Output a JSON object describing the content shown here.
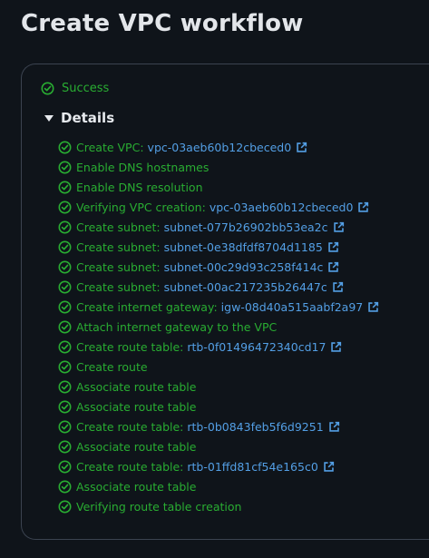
{
  "page": {
    "title": "Create VPC workflow"
  },
  "status": {
    "text": "Success",
    "icon": "check-circle-icon",
    "color": "#29ad32"
  },
  "details": {
    "title": "Details"
  },
  "colors": {
    "success": "#29ad32",
    "link": "#539fe5",
    "background": "#0f141a"
  },
  "steps": [
    {
      "label": "Create VPC:",
      "link": "vpc-03aeb60b12cbeced0"
    },
    {
      "label": "Enable DNS hostnames"
    },
    {
      "label": "Enable DNS resolution"
    },
    {
      "label": "Verifying VPC creation:",
      "link": "vpc-03aeb60b12cbeced0"
    },
    {
      "label": "Create subnet:",
      "link": "subnet-077b26902bb53ea2c"
    },
    {
      "label": "Create subnet:",
      "link": "subnet-0e38dfdf8704d1185"
    },
    {
      "label": "Create subnet:",
      "link": "subnet-00c29d93c258f414c"
    },
    {
      "label": "Create subnet:",
      "link": "subnet-00ac217235b26447c"
    },
    {
      "label": "Create internet gateway:",
      "link": "igw-08d40a515aabf2a97"
    },
    {
      "label": "Attach internet gateway to the VPC"
    },
    {
      "label": "Create route table:",
      "link": "rtb-0f01496472340cd17"
    },
    {
      "label": "Create route"
    },
    {
      "label": "Associate route table"
    },
    {
      "label": "Associate route table"
    },
    {
      "label": "Create route table:",
      "link": "rtb-0b0843feb5f6d9251"
    },
    {
      "label": "Associate route table"
    },
    {
      "label": "Create route table:",
      "link": "rtb-01ffd81cf54e165c0"
    },
    {
      "label": "Associate route table"
    },
    {
      "label": "Verifying route table creation"
    }
  ]
}
